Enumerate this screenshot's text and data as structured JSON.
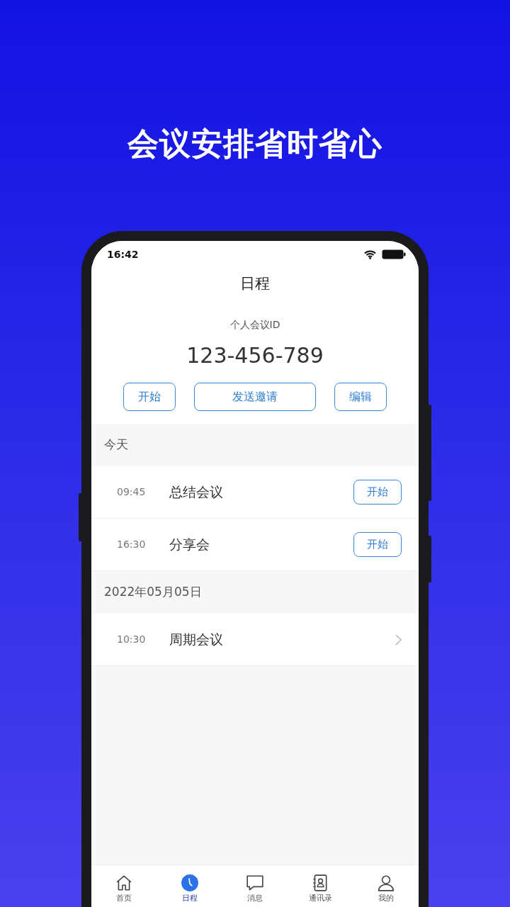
{
  "headline": "会议安排省时省心",
  "status_bar": {
    "time": "16:42"
  },
  "title": "日程",
  "meeting_id": {
    "label": "个人会议ID",
    "value": "123-456-789"
  },
  "actions": [
    {
      "label": "开始",
      "kind": "short"
    },
    {
      "label": "发送邀请",
      "kind": "wide"
    },
    {
      "label": "编辑",
      "kind": "short"
    }
  ],
  "sections": [
    {
      "header": "今天",
      "meetings": [
        {
          "time": "09:45",
          "name": "总结会议",
          "kind": "startable",
          "button": "开始"
        },
        {
          "time": "16:30",
          "name": "分享会",
          "kind": "startable",
          "button": "开始"
        }
      ]
    },
    {
      "header": "2022年05月05日",
      "meetings": [
        {
          "time": "10:30",
          "name": "周期会议",
          "kind": "recurring"
        }
      ]
    }
  ],
  "tabs": [
    {
      "label": "首页",
      "kind": "home",
      "selected": false
    },
    {
      "label": "日程",
      "kind": "clock",
      "selected": true
    },
    {
      "label": "消息",
      "kind": "chat",
      "selected": false
    },
    {
      "label": "通讯录",
      "kind": "contacts",
      "selected": false
    },
    {
      "label": "我的",
      "kind": "person",
      "selected": false
    }
  ]
}
